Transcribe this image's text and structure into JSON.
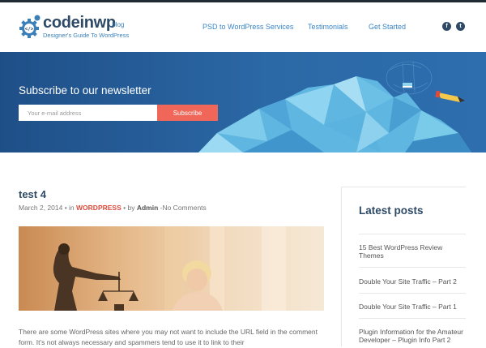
{
  "brand": {
    "name": "codeinwp",
    "tld": ".blog",
    "tagline": "Designer's Guide To WordPress"
  },
  "nav": {
    "items": [
      "PSD to WordPress Services",
      "Testimonials",
      "Get Started"
    ]
  },
  "social": {
    "facebook": "f",
    "twitter": "t"
  },
  "newsletter": {
    "title": "Subscribe to our newsletter",
    "placeholder": "Your e-mail address",
    "button": "Subscribe"
  },
  "post": {
    "title": "test 4",
    "date": "March 2, 2014",
    "in_text": " • in ",
    "category": "WORDPRESS",
    "by_text": " • by ",
    "author": "Admin",
    "comments": " -No Comments",
    "excerpt": "There are some WordPress sites where you may not want to include the URL field in the comment form. It’s not always necessary and spammers tend to use it to link to their"
  },
  "sidebar": {
    "title": "Latest posts",
    "items": [
      "15 Best WordPress Review Themes",
      "Double Your Site Traffic – Part 2",
      "Double Your Site Traffic – Part 1",
      "Plugin Information for the Amateur Developer – Plugin Info Part 2"
    ]
  },
  "colors": {
    "brand_navy": "#2e4a66",
    "link_blue": "#3a86c8",
    "accent_red": "#f0675a",
    "banner_blue": "#2b68a6"
  }
}
